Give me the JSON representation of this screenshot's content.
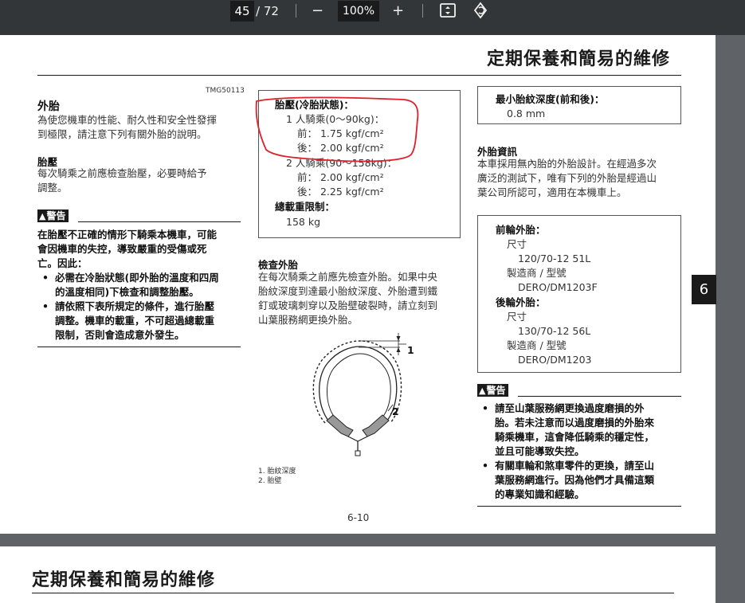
{
  "toolbar": {
    "current_page": "45",
    "total_pages": "/ 72",
    "zoom_out": "−",
    "zoom_level": "100%",
    "zoom_in": "+",
    "icons": [
      "fit-page-icon",
      "rotate-icon"
    ]
  },
  "page": {
    "chapter_title": "定期保養和簡易的維修",
    "page_number": "6-10",
    "chapter_tab": "6",
    "left": {
      "doc_code": "TMG50113",
      "tire_heading": "外胎",
      "tire_intro": [
        "為使您機車的性能、耐久性和安全性發揮",
        "到極限，請注意下列有關外胎的說明。"
      ],
      "pressure_heading": "胎壓",
      "pressure_text": [
        "每次騎乘之前應檢查胎壓，必要時給予",
        "調整。"
      ],
      "warning_label": "警告",
      "warning_lines": [
        "在胎壓不正確的情形下騎乘本機車，可能",
        "會因機車的失控，導致嚴重的受傷或死",
        "亡。因此："
      ],
      "warning_bullets": [
        [
          "必需在冷胎狀態(即外胎的溫度和四周",
          "的溫度相同)下檢查和調整胎壓。"
        ],
        [
          "請依照下表所規定的條件，進行胎壓",
          "調整。機車的載重，不可超過總載重",
          "限制，否則會造成意外發生。"
        ]
      ]
    },
    "middle": {
      "pressure_box": {
        "title": "胎壓(冷胎狀態)：",
        "one_rider": "1 人騎乘(0〜90kg)：",
        "one_front": "前：  1.75 kgf/cm²",
        "one_rear": "後：  2.00 kgf/cm²",
        "two_rider": "2 人騎乘(90〜158kg)：",
        "two_front": "前：  2.00 kgf/cm²",
        "two_rear": "後：  2.25 kgf/cm²",
        "load_title": "總載重限制：",
        "load_value": "158 kg"
      },
      "inspect_heading": "檢查外胎",
      "inspect_text": [
        "在每次騎乘之前應先檢查外胎。如果中央",
        "胎紋深度到達最小胎紋深度、外胎遭到鐵",
        "釘或玻璃刺穿以及胎壁破裂時，請立刻到",
        "山葉服務網更換外胎。"
      ],
      "diagram_callouts": [
        "1",
        "2"
      ],
      "captions": [
        "1.  胎紋深度",
        "2.  胎壁"
      ]
    },
    "right": {
      "tread_box": {
        "title": "最小胎紋深度(前和後)：",
        "value": "0.8 mm"
      },
      "tire_info_heading": "外胎資訊",
      "tire_info_text": [
        "本車採用無內胎的外胎設計。在經過多次",
        "廣泛的測試下，唯有下列的外胎是經過山",
        "葉公司所認可，適用在本機車上。"
      ],
      "tire_box": {
        "front_title": "前輪外胎：",
        "front_size_label": "尺寸",
        "front_size": "120/70-12 51L",
        "front_maker_label": "製造商 / 型號",
        "front_model": "DERO/DM1203F",
        "rear_title": "後輪外胎：",
        "rear_size_label": "尺寸",
        "rear_size": "130/70-12 56L",
        "rear_maker_label": "製造商 / 型號",
        "rear_model": "DERO/DM1203"
      },
      "warning_label": "警告",
      "warning_bullets": [
        [
          "請至山葉服務網更換過度磨損的外",
          "胎。若未注意而以過度磨損的外胎來",
          "騎乘機車，這會降低騎乘的穩定性，",
          "並且可能導致失控。"
        ],
        [
          "有關車輪和煞車零件的更換，請至山",
          "葉服務網進行。因為他們才具備這類",
          "的專業知識和經驗。"
        ]
      ]
    }
  },
  "next_page": {
    "chapter_title": "定期保養和簡易的維修"
  },
  "colors": {
    "toolbar_bg": "#323639",
    "viewer_bg": "#5f6368",
    "annotation_red": "#e0202a"
  }
}
